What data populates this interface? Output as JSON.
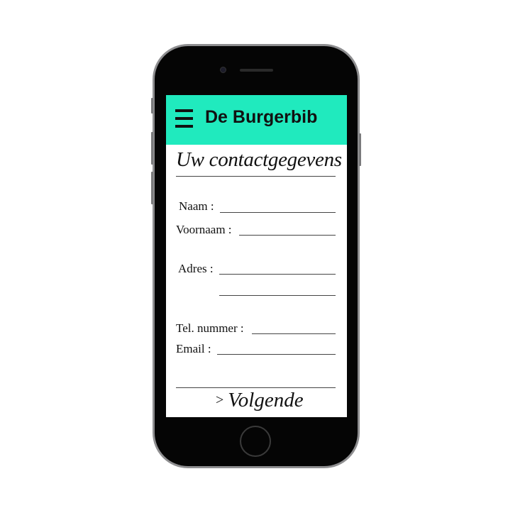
{
  "header": {
    "menu_icon": "hamburger-menu-icon",
    "brand": "De Burgerbib",
    "brand_color": "#20eabe"
  },
  "form": {
    "title": "Uw contactgegevens",
    "fields": {
      "naam": {
        "label": "Naam :",
        "value": ""
      },
      "voornaam": {
        "label": "Voornaam :",
        "value": ""
      },
      "adres": {
        "label": "Adres :",
        "value": ""
      },
      "tel": {
        "label": "Tel. nummer :",
        "value": ""
      },
      "email": {
        "label": "Email :",
        "value": ""
      }
    }
  },
  "footer": {
    "next_arrow": ">",
    "next_label": "Volgende"
  }
}
